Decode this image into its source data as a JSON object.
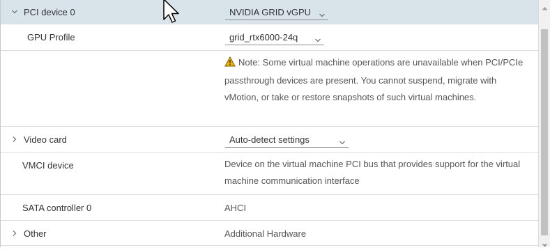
{
  "rows": {
    "pci": {
      "label": "PCI device 0",
      "value": "NVIDIA GRID vGPU"
    },
    "gpu_profile": {
      "label": "GPU Profile",
      "value": "grid_rtx6000-24q"
    },
    "note": "Note: Some virtual machine operations are unavailable when PCI/PCIe passthrough devices are present. You cannot suspend, migrate with vMotion, or take or restore snapshots of such virtual machines.",
    "video_card": {
      "label": "Video card",
      "value": "Auto-detect settings"
    },
    "vmci": {
      "label": "VMCI device",
      "value": "Device on the virtual machine PCI bus that provides support for the virtual machine communication interface"
    },
    "sata": {
      "label": "SATA controller 0",
      "value": "AHCI"
    },
    "other": {
      "label": "Other",
      "value": "Additional Hardware"
    }
  },
  "icons": {
    "expanded": "chevron-down-icon",
    "collapsed": "chevron-right-icon",
    "warning": "warning-icon",
    "dropdown": "caret-down-icon"
  },
  "colors": {
    "selected_row": "#d8e3ea",
    "warning": "#f0b400"
  }
}
